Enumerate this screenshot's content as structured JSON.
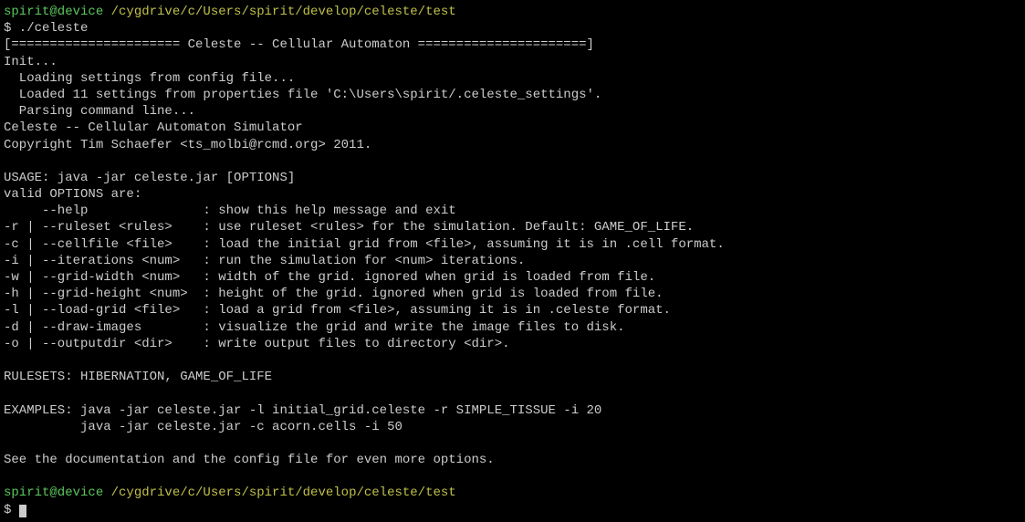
{
  "prompt1": {
    "user": "spirit@device",
    "path": " /cygdrive/c/Users/spirit/develop/celeste/test"
  },
  "command1": "$ ./celeste",
  "lines": [
    "[====================== Celeste -- Cellular Automaton ======================]",
    "Init...",
    "  Loading settings from config file...",
    "  Loaded 11 settings from properties file 'C:\\Users\\spirit/.celeste_settings'.",
    "  Parsing command line...",
    "Celeste -- Cellular Automaton Simulator",
    "Copyright Tim Schaefer <ts_molbi@rcmd.org> 2011.",
    "",
    "USAGE: java -jar celeste.jar [OPTIONS]",
    "valid OPTIONS are:",
    "     --help               : show this help message and exit",
    "-r | --ruleset <rules>    : use ruleset <rules> for the simulation. Default: GAME_OF_LIFE.",
    "-c | --cellfile <file>    : load the initial grid from <file>, assuming it is in .cell format.",
    "-i | --iterations <num>   : run the simulation for <num> iterations.",
    "-w | --grid-width <num>   : width of the grid. ignored when grid is loaded from file.",
    "-h | --grid-height <num>  : height of the grid. ignored when grid is loaded from file.",
    "-l | --load-grid <file>   : load a grid from <file>, assuming it is in .celeste format.",
    "-d | --draw-images        : visualize the grid and write the image files to disk.",
    "-o | --outputdir <dir>    : write output files to directory <dir>.",
    "",
    "RULESETS: HIBERNATION, GAME_OF_LIFE",
    "",
    "EXAMPLES: java -jar celeste.jar -l initial_grid.celeste -r SIMPLE_TISSUE -i 20",
    "          java -jar celeste.jar -c acorn.cells -i 50",
    "",
    "See the documentation and the config file for even more options.",
    ""
  ],
  "prompt2": {
    "user": "spirit@device",
    "path": " /cygdrive/c/Users/spirit/develop/celeste/test"
  },
  "command2": "$ "
}
